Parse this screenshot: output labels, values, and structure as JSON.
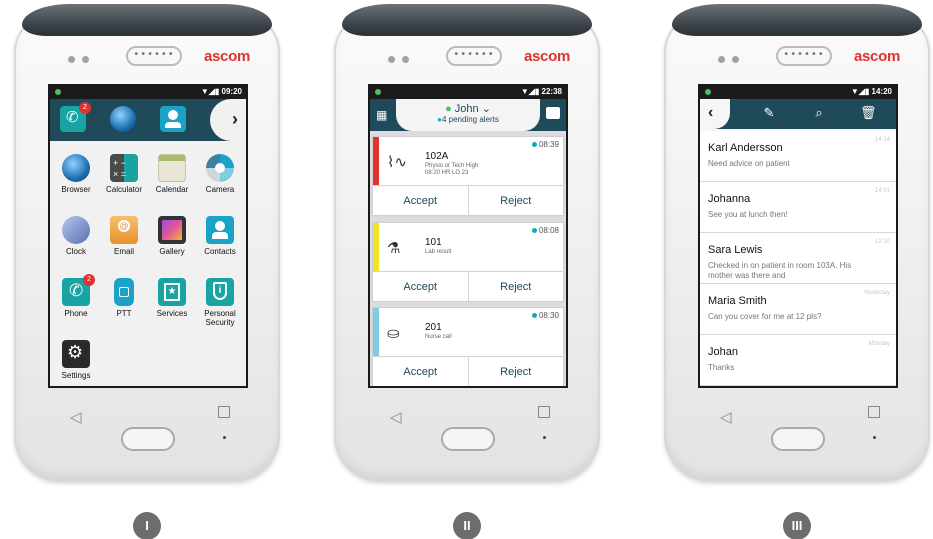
{
  "phones": [
    {
      "brand": "ascom",
      "speaker": "••••••",
      "label": "I",
      "status_time": "09:20",
      "apps": [
        {
          "label": "Browser",
          "icon": "globe-icon"
        },
        {
          "label": "Calculator",
          "icon": "calculator-icon"
        },
        {
          "label": "Calendar",
          "icon": "calendar-icon"
        },
        {
          "label": "Camera",
          "icon": "camera-icon"
        },
        {
          "label": "Clock",
          "icon": "clock-icon"
        },
        {
          "label": "Email",
          "icon": "email-icon"
        },
        {
          "label": "Gallery",
          "icon": "gallery-icon"
        },
        {
          "label": "Contacts",
          "icon": "contacts-icon"
        },
        {
          "label": "Phone",
          "icon": "phone-icon",
          "badge": "2"
        },
        {
          "label": "PTT",
          "icon": "ptt-icon"
        },
        {
          "label": "Services",
          "icon": "services-icon"
        },
        {
          "label": "Personal Security",
          "icon": "security-icon"
        },
        {
          "label": "Settings",
          "icon": "settings-icon"
        }
      ],
      "dock_badge": "2"
    },
    {
      "brand": "ascom",
      "speaker": "••••••",
      "label": "II",
      "status_time": "22:38",
      "user": "John",
      "pending": "4 pending alerts",
      "alerts": [
        {
          "room": "102A",
          "desc1": "Physio or Tech High",
          "desc2": "08:20 HR LO 23",
          "time": "08:39",
          "color": "#e0322f",
          "accept": "Accept",
          "reject": "Reject",
          "icon": "heartbeat-icon"
        },
        {
          "room": "101",
          "desc1": "Lab result",
          "desc2": "",
          "time": "08:08",
          "color": "#f1e32a",
          "accept": "Accept",
          "reject": "Reject",
          "icon": "flask-icon"
        },
        {
          "room": "201",
          "desc1": "Nurse call",
          "desc2": "",
          "time": "08:30",
          "color": "#7ecce0",
          "accept": "Accept",
          "reject": "Reject",
          "icon": "bed-icon"
        }
      ]
    },
    {
      "brand": "ascom",
      "speaker": "••••••",
      "label": "III",
      "status_time": "14:20",
      "messages": [
        {
          "name": "Karl Andersson",
          "text": "Need advice on patient",
          "time": "14:14"
        },
        {
          "name": "Johanna",
          "text": "See you at lunch then!",
          "time": "14:01"
        },
        {
          "name": "Sara Lewis",
          "text": "Checked in on patient in room 103A. His mother was there and",
          "time": "12:10"
        },
        {
          "name": "Maria Smith",
          "text": "Can you cover for me at 12 pls?",
          "time": "Yesterday"
        },
        {
          "name": "Johan",
          "text": "Thanks",
          "time": "Monday"
        }
      ]
    }
  ],
  "colors": {
    "accent": "#1e4a59",
    "brand": "#e0322f",
    "status_dot": "#4cc15a"
  }
}
